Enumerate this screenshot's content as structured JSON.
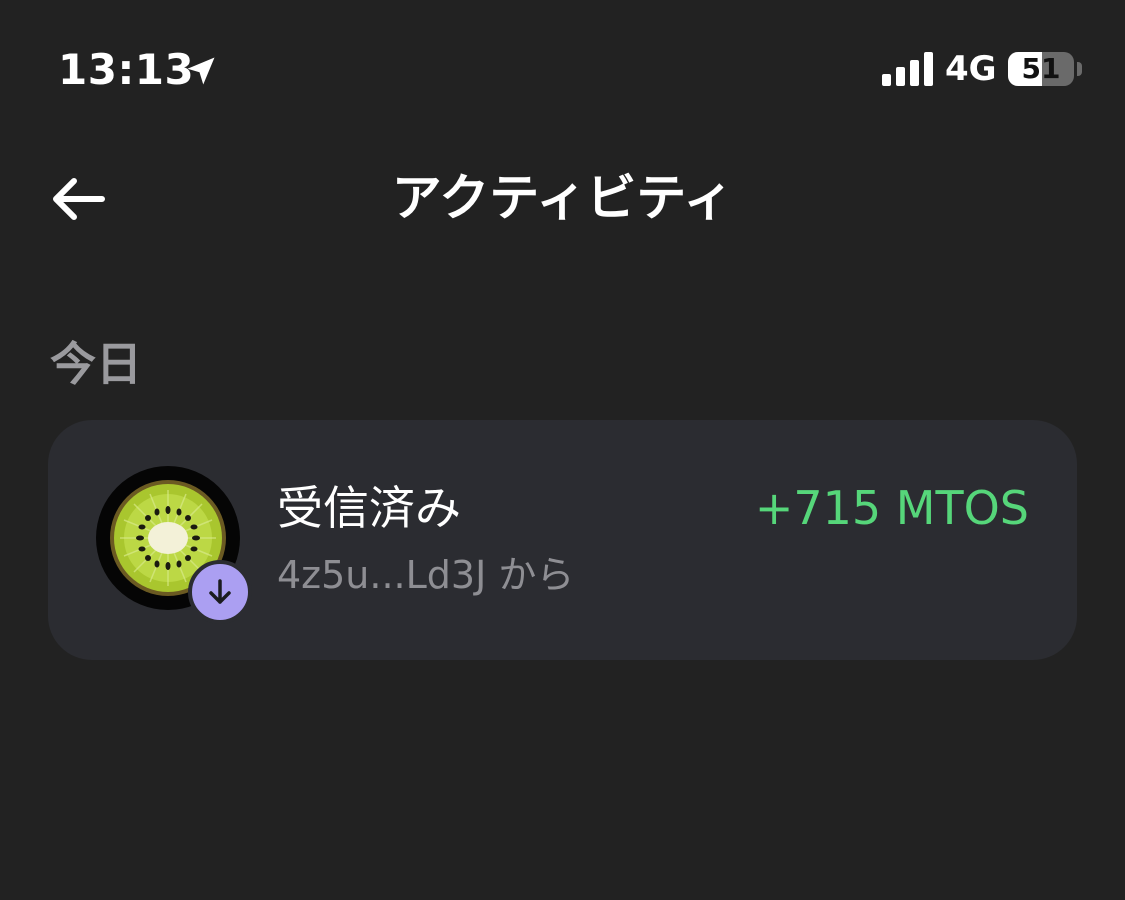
{
  "status_bar": {
    "time": "13:13",
    "location_icon": "location-arrow-icon",
    "signal_icon": "cellular-signal-icon",
    "network": "4G",
    "battery_percent": 51,
    "battery_label": "51"
  },
  "header": {
    "back_icon": "arrow-left-icon",
    "title": "アクティビティ"
  },
  "sections": [
    {
      "heading": "今日",
      "items": [
        {
          "avatar_icon": "kiwi-token-icon",
          "badge_icon": "arrow-down-icon",
          "title": "受信済み",
          "subtitle": "4z5u...Ld3J から",
          "amount": "+715 MTOS"
        }
      ]
    }
  ],
  "colors": {
    "background": "#222222",
    "card": "#2b2c31",
    "amount_positive": "#56d67a",
    "badge": "#ab9ff2",
    "muted_text": "#8e8e93"
  }
}
